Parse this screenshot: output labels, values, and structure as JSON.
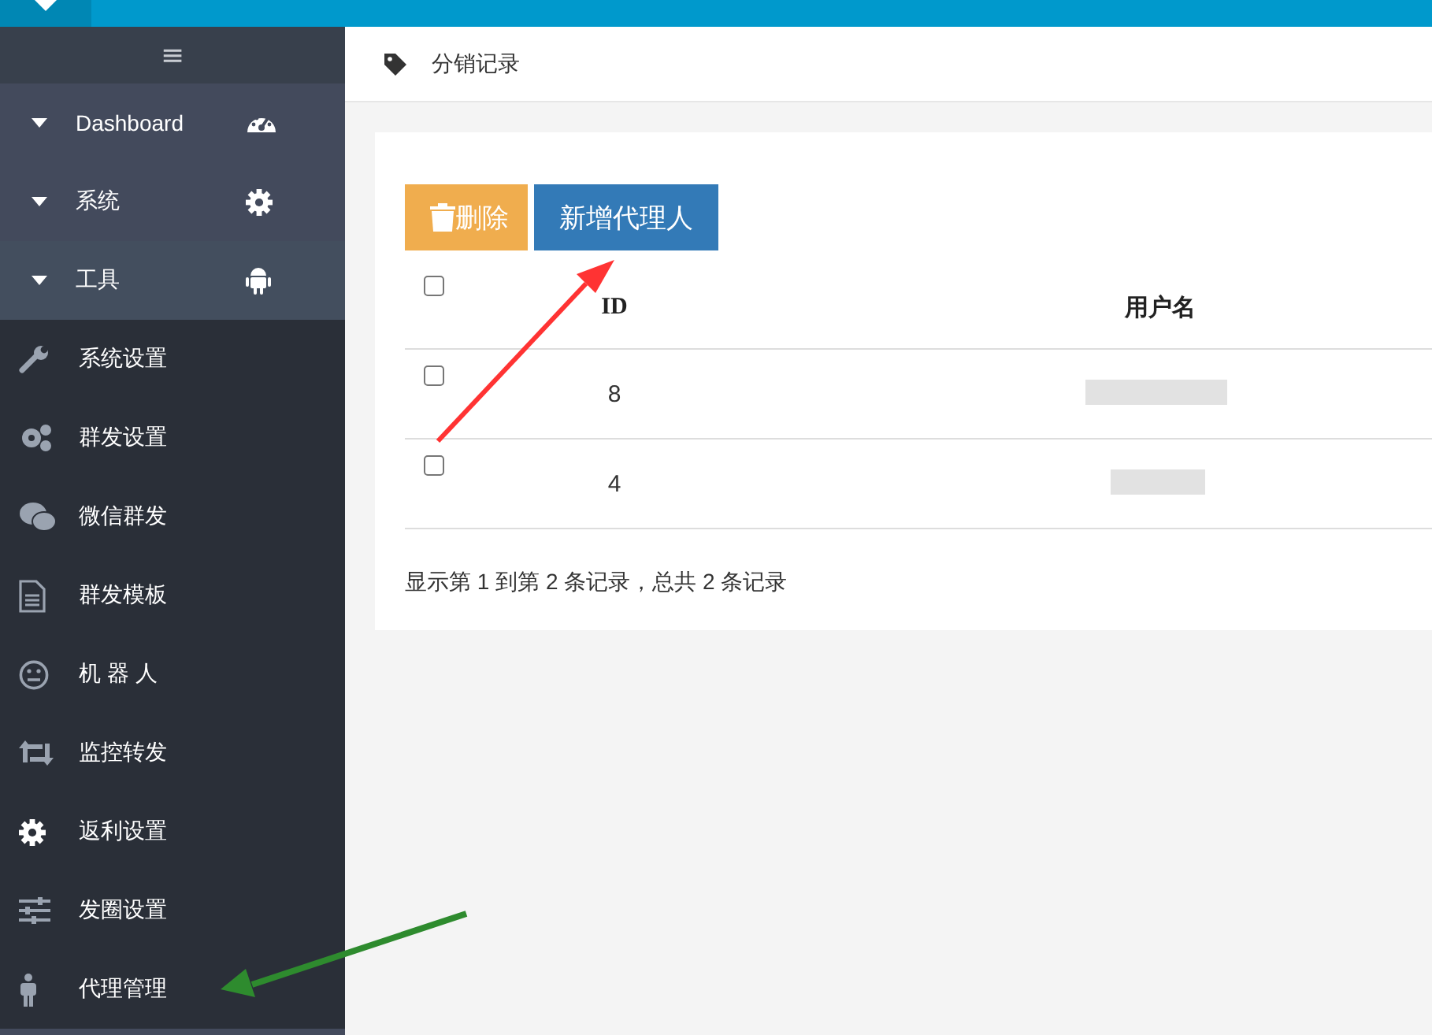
{
  "sidebar": {
    "toggle": "≡",
    "items": [
      {
        "kind": "group",
        "label": "Dashboard"
      },
      {
        "kind": "group",
        "label": "系统"
      },
      {
        "kind": "group",
        "label": "工具"
      },
      {
        "kind": "item",
        "label": "系统设置"
      },
      {
        "kind": "item",
        "label": "群发设置"
      },
      {
        "kind": "item",
        "label": "微信群发"
      },
      {
        "kind": "item",
        "label": "群发模板"
      },
      {
        "kind": "item",
        "label": "机 器 人"
      },
      {
        "kind": "item",
        "label": "监控转发"
      },
      {
        "kind": "item",
        "label": "返利设置"
      },
      {
        "kind": "item",
        "label": "发圈设置"
      },
      {
        "kind": "item",
        "label": "代理管理"
      }
    ]
  },
  "breadcrumb": "分销记录",
  "toolbar": {
    "delete": "删除",
    "add": "新增代理人"
  },
  "table": {
    "columns": [
      "ID",
      "用户名"
    ],
    "header_checked": false,
    "rows": [
      {
        "id": "8",
        "checked": false
      },
      {
        "id": "4",
        "checked": false
      }
    ]
  },
  "summary": "显示第 1 到第 2 条记录，总共 2 条记录"
}
